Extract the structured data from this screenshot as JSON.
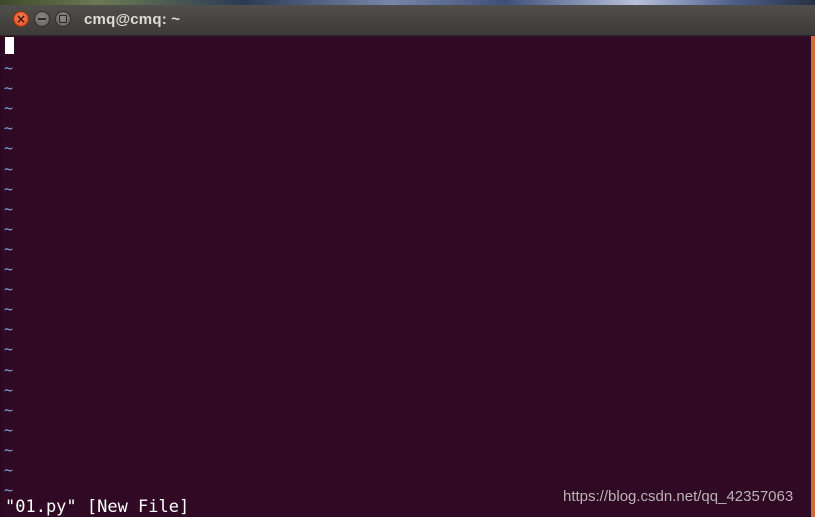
{
  "window": {
    "title": "cmq@cmq: ~"
  },
  "title_buttons": {
    "close_icon": "close-icon",
    "minimize_icon": "minimize-icon",
    "maximize_icon": "maximize-icon"
  },
  "terminal": {
    "tilde": "~",
    "tilde_line_count": 22,
    "status_line": "\"01.py\" [New File]",
    "watermark": "https://blog.csdn.net/qq_42357063"
  },
  "colors": {
    "background": "#300a24",
    "tilde": "#7da2d9",
    "close_button": "#df4a16",
    "titlebar": "#3c3b37"
  }
}
